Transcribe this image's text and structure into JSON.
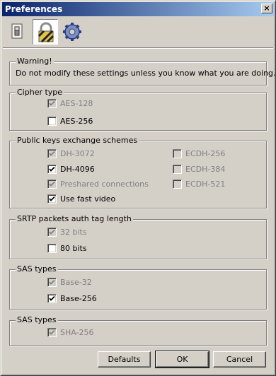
{
  "window": {
    "title": "Preferences",
    "close_glyph": "×"
  },
  "toolbar": {
    "items": [
      {
        "icon": "switch-icon",
        "selected": false
      },
      {
        "icon": "padlock-icon",
        "selected": true
      },
      {
        "icon": "gear-icon",
        "selected": false
      }
    ]
  },
  "warning": {
    "title": "Warning!",
    "text": "Do not modify these settings unless you know what you are doing."
  },
  "cipher": {
    "title": "Cipher type",
    "options": [
      {
        "label": "AES-128",
        "checked": true,
        "enabled": false
      },
      {
        "label": "AES-256",
        "checked": false,
        "enabled": true
      }
    ]
  },
  "pubkeys": {
    "title": "Public keys exchange schemes",
    "left": [
      {
        "label": "DH-3072",
        "checked": true,
        "enabled": false
      },
      {
        "label": "DH-4096",
        "checked": true,
        "enabled": true
      },
      {
        "label": "Preshared connections",
        "checked": true,
        "enabled": false
      },
      {
        "label": "Use fast video",
        "checked": true,
        "enabled": true
      }
    ],
    "right": [
      {
        "label": "ECDH-256",
        "checked": false,
        "enabled": false
      },
      {
        "label": "ECDH-384",
        "checked": false,
        "enabled": false
      },
      {
        "label": "ECDH-521",
        "checked": false,
        "enabled": false
      }
    ]
  },
  "srtp": {
    "title": "SRTP packets auth tag length",
    "options": [
      {
        "label": "32 bits",
        "checked": true,
        "enabled": false
      },
      {
        "label": "80 bits",
        "checked": false,
        "enabled": true
      }
    ]
  },
  "sas_types": {
    "title": "SAS types",
    "options": [
      {
        "label": "Base-32",
        "checked": true,
        "enabled": false
      },
      {
        "label": "Base-256",
        "checked": true,
        "enabled": true
      }
    ]
  },
  "sas_hash": {
    "title": "SAS types",
    "options": [
      {
        "label": "SHA-256",
        "checked": true,
        "enabled": false
      }
    ]
  },
  "buttons": {
    "defaults": "Defaults",
    "ok": "OK",
    "cancel": "Cancel"
  }
}
